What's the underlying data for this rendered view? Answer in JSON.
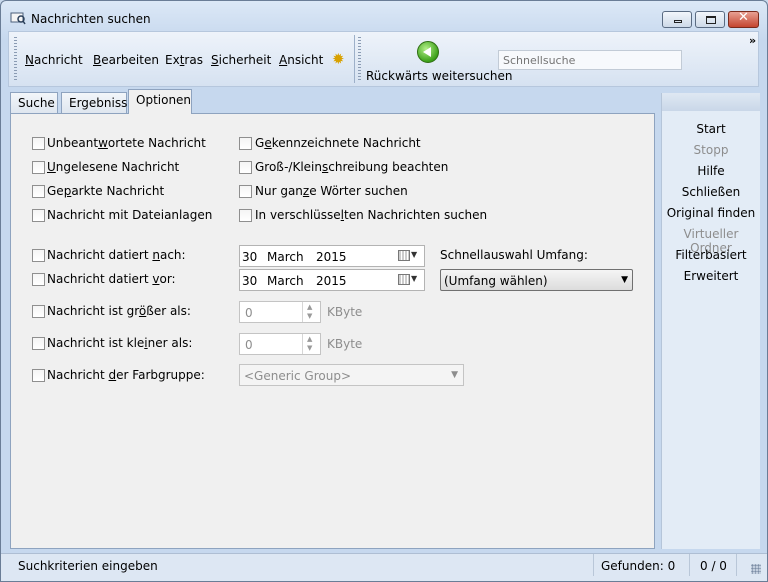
{
  "window": {
    "title": "Nachrichten suchen"
  },
  "toolbar": {
    "menu": [
      {
        "pre": "",
        "ul": "N",
        "post": "achricht"
      },
      {
        "pre": "",
        "ul": "B",
        "post": "earbeiten"
      },
      {
        "pre": "Ex",
        "ul": "t",
        "post": "ras"
      },
      {
        "pre": "",
        "ul": "S",
        "post": "icherheit"
      },
      {
        "pre": "",
        "ul": "A",
        "post": "nsicht"
      }
    ],
    "back_label": "Rückwärts weitersuchen",
    "search_placeholder": "Schnellsuche",
    "overflow": "»"
  },
  "tabs": [
    "Suche",
    "Ergebnisse",
    "Optionen"
  ],
  "options": {
    "col1": [
      {
        "pre": "Unbeant",
        "ul": "w",
        "post": "ortete Nachricht"
      },
      {
        "pre": "",
        "ul": "U",
        "post": "ngelesene Nachricht"
      },
      {
        "pre": "Ge",
        "ul": "p",
        "post": "arkte Nachricht"
      },
      {
        "pre": "Nachricht mit Dateianlagen",
        "ul": "",
        "post": ""
      }
    ],
    "col2": [
      {
        "pre": "G",
        "ul": "e",
        "post": "kennzeichnete Nachricht"
      },
      {
        "pre": "Groß-/Klein",
        "ul": "s",
        "post": "chreibung beachten"
      },
      {
        "pre": "Nur gan",
        "ul": "z",
        "post": "e Wörter suchen"
      },
      {
        "pre": "In verschlüsse",
        "ul": "l",
        "post": "ten Nachrichten suchen"
      }
    ],
    "dated_after": {
      "pre": "Nachricht datiert ",
      "ul": "n",
      "post": "ach:",
      "day": "30",
      "month": "March",
      "year": "2015"
    },
    "dated_before": {
      "pre": "Nachricht datiert ",
      "ul": "v",
      "post": "or:",
      "day": "30",
      "month": "March",
      "year": "2015"
    },
    "quick_scope_label": "Schnellauswahl Umfang:",
    "quick_scope_value": "(Umfang wählen)",
    "larger": {
      "pre": "Nachricht ist gr",
      "ul": "ö",
      "post": "ßer als:",
      "value": "0",
      "unit": "KByte"
    },
    "smaller": {
      "pre": "Nachricht ist kle",
      "ul": "i",
      "post": "ner als:",
      "value": "0",
      "unit": "KByte"
    },
    "color_group": {
      "pre": "Nachricht ",
      "ul": "d",
      "post": "er Farbgruppe:",
      "value": "<Generic Group>"
    }
  },
  "sidebar": [
    {
      "label": "Start",
      "enabled": true
    },
    {
      "label": "Stopp",
      "enabled": false
    },
    {
      "label": "Hilfe",
      "enabled": true
    },
    {
      "label": "Schließen",
      "enabled": true
    },
    {
      "label": "Original finden",
      "enabled": true
    },
    {
      "label": "Virtueller Ordner",
      "enabled": false
    },
    {
      "label": "Filterbasiert",
      "enabled": true
    },
    {
      "label": "Erweitert",
      "enabled": true
    }
  ],
  "status": {
    "message": "Suchkriterien eingeben",
    "found": "Gefunden: 0",
    "count": "0 / 0"
  }
}
